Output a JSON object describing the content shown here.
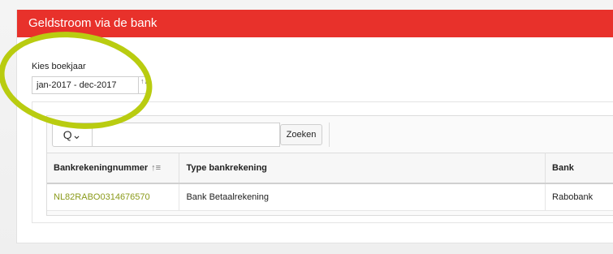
{
  "panel": {
    "title": "Geldstroom via de bank"
  },
  "year_filter": {
    "label": "Kies boekjaar",
    "selected": "jan-2017 - dec-2017",
    "spinner": "↑↓"
  },
  "search": {
    "toggle_icon": "Q⌄",
    "input_value": "",
    "button_label": "Zoeken"
  },
  "table": {
    "columns": [
      {
        "label": "Bankrekeningnummer",
        "sort_icon": "↑≡"
      },
      {
        "label": "Type bankrekening"
      },
      {
        "label": "Bank"
      }
    ],
    "rows": [
      {
        "account_number": "NL82RABO0314676570",
        "type": "Bank Betaalrekening",
        "bank": "Rabobank"
      }
    ]
  },
  "colors": {
    "header": "#e8312b",
    "link": "#8a9a1a",
    "highlight_circle": "#b9cc10"
  }
}
